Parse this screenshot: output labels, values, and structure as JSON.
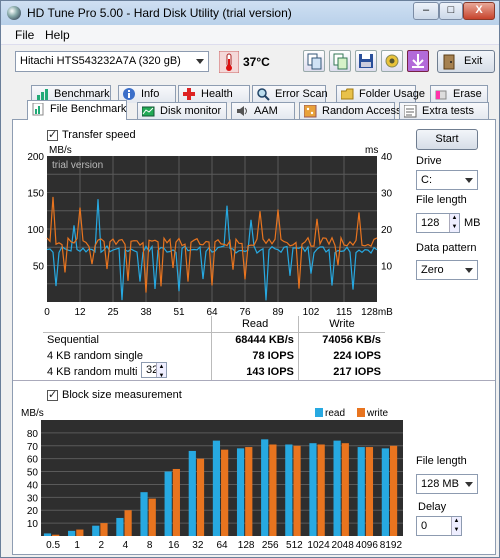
{
  "window": {
    "title": "HD Tune Pro 5.00 - Hard Disk Utility (trial version)",
    "controls": [
      "–",
      "□",
      "X"
    ]
  },
  "menu": [
    "File",
    "Help"
  ],
  "toolbar": {
    "drive": "Hitachi HTS543232A7A    (320 gB)",
    "temperature": "37°C",
    "exit_label": "Exit"
  },
  "tabs_back": [
    "Benchmark",
    "Info",
    "Health",
    "Error Scan",
    "Folder Usage",
    "Erase"
  ],
  "tabs_front": [
    "File Benchmark",
    "Disk monitor",
    "AAM",
    "Random Access",
    "Extra tests"
  ],
  "transfer": {
    "checkbox_label": "Transfer speed",
    "watermark": "trial version",
    "y_left_unit": "MB/s",
    "y_right_unit": "ms",
    "y_left_ticks": [
      "200",
      "150",
      "100",
      "50"
    ],
    "y_right_ticks": [
      "40",
      "30",
      "20",
      "10"
    ],
    "x_ticks": [
      "0",
      "12",
      "25",
      "38",
      "51",
      "64",
      "76",
      "89",
      "102",
      "115",
      "128mB"
    ],
    "header_read": "Read",
    "header_write": "Write",
    "rows": [
      {
        "label": "Sequential",
        "read": "68444 KB/s",
        "write": "74056 KB/s"
      },
      {
        "label": "4 KB random single",
        "read": "78 IOPS",
        "write": "224 IOPS"
      },
      {
        "label": "4 KB random multi",
        "read": "143 IOPS",
        "write": "217 IOPS"
      }
    ],
    "queue_depth": "32"
  },
  "right_panel": {
    "start_label": "Start",
    "drive_label": "Drive",
    "drive_value": "C:",
    "file_length_label": "File length",
    "file_length_value": "128",
    "file_length_unit": "MB",
    "pattern_label": "Data pattern",
    "pattern_value": "Zero"
  },
  "block": {
    "checkbox_label": "Block size measurement",
    "file_length_label": "File length",
    "file_length_value": "128 MB",
    "delay_label": "Delay",
    "delay_value": "0"
  },
  "chart_data": {
    "type": "bar",
    "ylabel": "MB/s",
    "ylim": [
      0,
      90
    ],
    "yticks": [
      "80",
      "70",
      "60",
      "50",
      "40",
      "30",
      "20",
      "10"
    ],
    "categories": [
      "0.5",
      "1",
      "2",
      "4",
      "8",
      "16",
      "32",
      "64",
      "128",
      "256",
      "512",
      "1024",
      "2048",
      "4096",
      "8192"
    ],
    "series": [
      {
        "name": "read",
        "color": "#27a9e1",
        "values": [
          2,
          4,
          8,
          14,
          34,
          50,
          66,
          74,
          68,
          75,
          71,
          72,
          74,
          69,
          68
        ]
      },
      {
        "name": "write",
        "color": "#e8741f",
        "values": [
          1,
          5,
          10,
          20,
          29,
          52,
          60,
          67,
          69,
          71,
          70,
          71,
          72,
          69,
          70
        ]
      }
    ],
    "legend": "top-right",
    "grid": true
  },
  "icons": [
    "disk-drive-icon",
    "thermometer-icon",
    "copy-icon",
    "copy2-icon",
    "save-icon",
    "camera-icon",
    "download-icon",
    "exit-door-icon"
  ],
  "colors": {
    "read": "#27a9e1",
    "write": "#e8741f",
    "plot_bg": "#2e2e2e",
    "grid": "#5a5a5a"
  }
}
